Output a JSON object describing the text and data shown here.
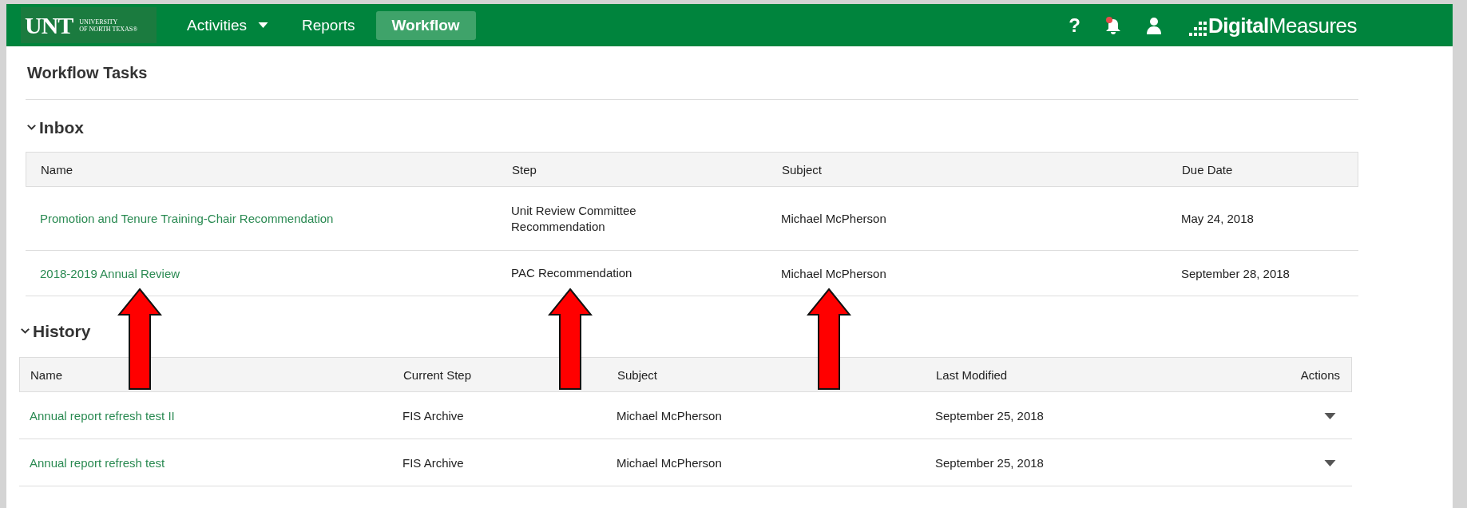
{
  "header": {
    "logo": {
      "mark": "UNT",
      "line1": "UNIVERSITY",
      "line2": "OF NORTH TEXAS®"
    },
    "nav": [
      {
        "label": "Activities",
        "dropdown": true,
        "selected": false
      },
      {
        "label": "Reports",
        "dropdown": false,
        "selected": false
      },
      {
        "label": "Workflow",
        "dropdown": false,
        "selected": true
      }
    ],
    "help": "?",
    "notifications_unread": true,
    "brand": "**Digital**Measures"
  },
  "page_title": "Workflow Tasks",
  "inbox": {
    "title": "Inbox",
    "expanded": true,
    "columns": [
      "Name",
      "Step",
      "Subject",
      "Due Date"
    ],
    "rows": [
      {
        "name": "Promotion and Tenure Training-Chair Recommendation",
        "step": "Unit Review Committee Recommendation",
        "subject": "Michael McPherson",
        "due": "May 24, 2018"
      },
      {
        "name": "2018-2019 Annual Review",
        "step": "PAC Recommendation",
        "subject": "Michael McPherson",
        "due": "September 28, 2018"
      }
    ]
  },
  "history": {
    "title": "History",
    "expanded": true,
    "columns": [
      "Name",
      "Current Step",
      "Subject",
      "Last Modified",
      "Actions"
    ],
    "rows": [
      {
        "name": "Annual report refresh test II",
        "step": "FIS Archive",
        "subject": "Michael McPherson",
        "modified": "September 25, 2018"
      },
      {
        "name": "Annual report refresh test",
        "step": "FIS Archive",
        "subject": "Michael McPherson",
        "modified": "September 25, 2018"
      }
    ]
  },
  "annotations": [
    {
      "kind": "arrow"
    },
    {
      "kind": "arrow"
    },
    {
      "kind": "arrow"
    }
  ]
}
